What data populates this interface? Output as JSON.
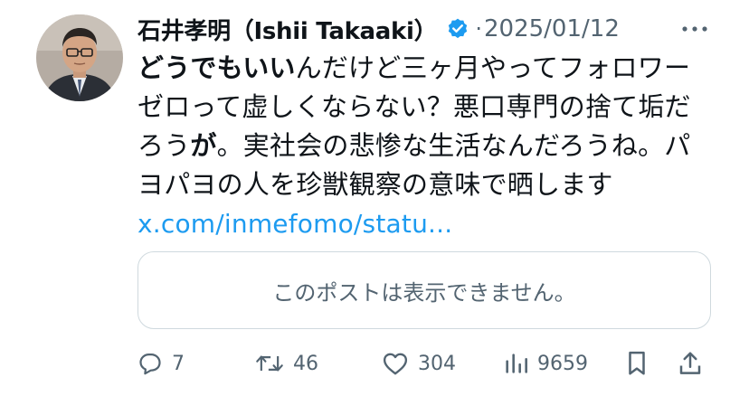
{
  "tweet": {
    "author_name": "石井孝明（Ishii Takaaki）",
    "separator": "·",
    "date": "2025/01/12",
    "body_lines": [
      [
        {
          "t": "どうでもいい",
          "b": true
        },
        {
          "t": "んだけど三ヶ月やってフォロワー",
          "b": false
        }
      ],
      [
        {
          "t": "ゼロって虚しくならない？悪口専門の捨て垢だ",
          "b": false
        }
      ],
      [
        {
          "t": "ろう",
          "b": false
        },
        {
          "t": "が",
          "b": true
        },
        {
          "t": "。実社会の悲惨な生活なんだろうね。パ",
          "b": false
        }
      ],
      [
        {
          "t": "ヨパヨの人を珍獣観察の意味で晒します",
          "b": false
        }
      ]
    ],
    "link_text": "x.com/inmefomo/statu...",
    "quote_unavailable": "このポストは表示できません。",
    "stats": {
      "replies": "7",
      "reposts": "46",
      "likes": "304",
      "views": "9659"
    },
    "icons": [
      "verified-badge-icon",
      "more-icon",
      "reply-icon",
      "repost-icon",
      "like-icon",
      "views-icon",
      "bookmark-icon",
      "share-icon"
    ],
    "colors": {
      "text": "#0f1419",
      "secondary": "#536471",
      "link": "#1d9bf0",
      "verified": "#1d9bf0",
      "border": "#cfd9de"
    }
  }
}
